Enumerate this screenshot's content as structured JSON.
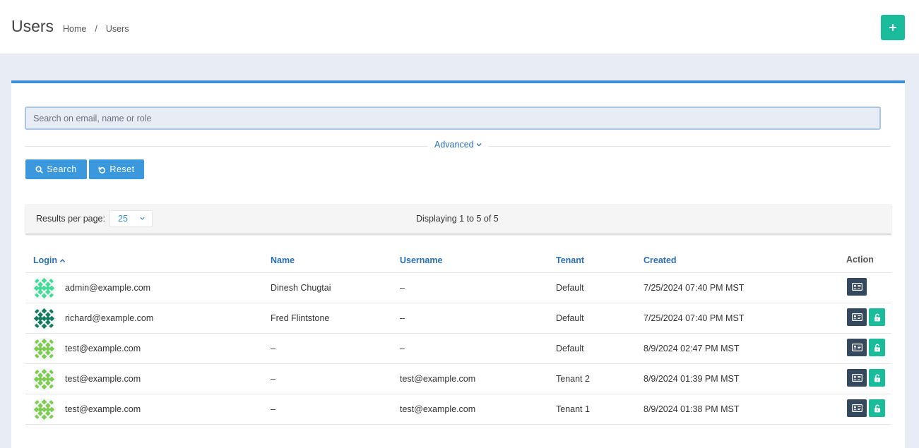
{
  "header": {
    "title": "Users",
    "breadcrumb": [
      "Home",
      "Users"
    ],
    "breadcrumb_sep": "/",
    "add_icon": "plus-icon"
  },
  "search": {
    "placeholder": "Search on email, name or role",
    "value": "",
    "advanced_label": "Advanced",
    "search_label": "Search",
    "reset_label": "Reset"
  },
  "pager": {
    "results_label": "Results per page:",
    "per_page": "25",
    "displaying": "Displaying 1 to 5 of 5"
  },
  "table": {
    "columns": {
      "login": "Login",
      "name": "Name",
      "username": "Username",
      "tenant": "Tenant",
      "created": "Created",
      "action": "Action"
    },
    "sort_column": "login",
    "sort_dir": "asc",
    "rows": [
      {
        "login": "admin@example.com",
        "name": "Dinesh Chugtai",
        "username": "–",
        "tenant": "Default",
        "created": "7/25/2024 07:40 PM MST",
        "unlock": false,
        "avatar_color": "#3ddc97"
      },
      {
        "login": "richard@example.com",
        "name": "Fred Flintstone",
        "username": "–",
        "tenant": "Default",
        "created": "7/25/2024 07:40 PM MST",
        "unlock": true,
        "avatar_color": "#127a5e"
      },
      {
        "login": "test@example.com",
        "name": "–",
        "username": "–",
        "tenant": "Default",
        "created": "8/9/2024 02:47 PM MST",
        "unlock": true,
        "avatar_color": "#7ccc4f"
      },
      {
        "login": "test@example.com",
        "name": "–",
        "username": "test@example.com",
        "tenant": "Tenant 2",
        "created": "8/9/2024 01:39 PM MST",
        "unlock": true,
        "avatar_color": "#7ccc4f"
      },
      {
        "login": "test@example.com",
        "name": "–",
        "username": "test@example.com",
        "tenant": "Tenant 1",
        "created": "8/9/2024 01:38 PM MST",
        "unlock": true,
        "avatar_color": "#7ccc4f"
      }
    ]
  },
  "colors": {
    "accent": "#3c98dc",
    "teal": "#1abc9c",
    "dark": "#34495e",
    "link": "#2a6fb0"
  }
}
